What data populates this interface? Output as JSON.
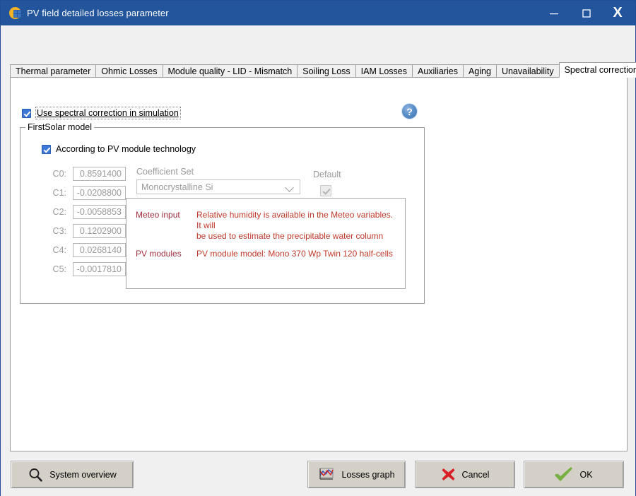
{
  "window": {
    "title": "PV field detailed losses parameter",
    "icon": "pv-sun-icon",
    "controls": {
      "minimize": "minimize-icon",
      "maximize": "maximize-icon",
      "close": "X"
    },
    "titlebar_color": "#22559c"
  },
  "tabs": [
    {
      "label": "Thermal parameter",
      "active": false
    },
    {
      "label": "Ohmic Losses",
      "active": false
    },
    {
      "label": "Module quality - LID - Mismatch",
      "active": false
    },
    {
      "label": "Soiling Loss",
      "active": false
    },
    {
      "label": "IAM Losses",
      "active": false
    },
    {
      "label": "Auxiliaries",
      "active": false
    },
    {
      "label": "Aging",
      "active": false
    },
    {
      "label": "Unavailability",
      "active": false
    },
    {
      "label": "Spectral correction",
      "active": true
    }
  ],
  "page": {
    "use_spectral": {
      "label": "Use spectral correction in simulation",
      "checked": true
    },
    "help": {
      "glyph": "?",
      "name": "help-icon"
    },
    "group": {
      "legend": "FirstSolar model",
      "according_checkbox": {
        "label": "According to PV module technology",
        "checked": true
      },
      "coefficients": [
        {
          "label": "C0:",
          "value": "0.8591400"
        },
        {
          "label": "C1:",
          "value": "-0.0208800"
        },
        {
          "label": "C2:",
          "value": "-0.0058853"
        },
        {
          "label": "C3:",
          "value": "0.1202900"
        },
        {
          "label": "C4:",
          "value": "0.0268140"
        },
        {
          "label": "C5:",
          "value": "-0.0017810"
        }
      ],
      "coefficient_set": {
        "label": "Coefficient Set",
        "value": "Monocrystalline Si"
      },
      "default": {
        "label": "Default",
        "checked": true
      },
      "info": [
        {
          "key": "Meteo input",
          "value": "Relative humidity is available in the Meteo variables. It will\nbe used to estimate the precipitable water column"
        },
        {
          "key": "PV modules",
          "value": "PV module model: Mono 370 Wp Twin 120 half-cells"
        }
      ]
    }
  },
  "buttons": {
    "system_overview": "System overview",
    "losses_graph": "Losses graph",
    "cancel": "Cancel",
    "ok": "OK"
  },
  "colors": {
    "title_bar": "#22559c",
    "info_text": "#c0392b",
    "accent_check": "#3b78d8",
    "cancel_x": "#d91f26",
    "ok_check": "#76b043"
  }
}
